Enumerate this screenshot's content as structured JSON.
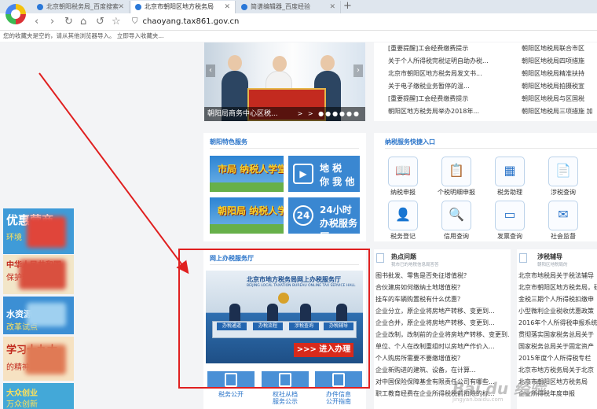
{
  "browser": {
    "tabs": [
      {
        "label": "北京朝阳税务局_百度搜索"
      },
      {
        "label": "北京市朝阳区地方税务局"
      },
      {
        "label": "简谱编辑器_百度经验"
      }
    ],
    "url": "chaoyang.tax861.gov.cn",
    "favbar_text": "您的收藏夹是空的，请从其他浏览器导入。  立即导入收藏夹..."
  },
  "carousel": {
    "caption": "朝阳局商务中心区税...",
    "dots": "> > ●●●●●●"
  },
  "news": {
    "left": [
      "[重要提醒]工会经费缴费提示",
      "关于个人所得税完税证明自助办税...",
      "北京市朝阳区地方税务局发文书...",
      "关于电子缴税业务暂停的温...",
      "[重要提醒]工会经费缴费提示",
      "朝阳区地方税务局举办2018年..."
    ],
    "right": [
      "朝阳区地税局联合市区",
      "朝阳区地税局四项措施",
      "朝阳区地税局精准扶持",
      "朝阳区地税局拍摄税宣",
      "朝阳区地税局与区国税",
      "朝阳区地税局三项措施 加"
    ]
  },
  "featured": {
    "title": "朝阳特色服务",
    "school1": "市局\n纳税人学堂",
    "school2": "朝阳局\n纳税人学堂",
    "tile1_l1": "地 税",
    "tile1_l2": "你 我 他",
    "tile2_l1": "24小时",
    "tile2_l2": "办税服务厅"
  },
  "quick": {
    "title": "纳税服务快捷入口",
    "items": [
      {
        "label": "纳税申报",
        "icon": "📖"
      },
      {
        "label": "个税明细申报",
        "icon": "📋"
      },
      {
        "label": "税务助理",
        "icon": "▦"
      },
      {
        "label": "涉税查询",
        "icon": "📄"
      },
      {
        "label": "税务登记",
        "icon": "👤"
      },
      {
        "label": "信用查询",
        "icon": "🔍"
      },
      {
        "label": "发票查询",
        "icon": "▭"
      },
      {
        "label": "社会监督",
        "icon": "✉"
      }
    ]
  },
  "online_hall": {
    "title": "网上办税服务厅",
    "hall_title": "北京市地方税务局网上办税服务厅",
    "hall_sub": "BEIJING LOCAL TAXATION BUREAU ONLINE TAX SERVICE HALL",
    "desks": [
      "办税通道",
      "办税流程",
      "涉税查询",
      "办税辅导"
    ],
    "enter": ">>> 进入办理",
    "bottom": [
      "税务公开",
      "权社从档\n服务公示",
      "办件信息\n公开指南"
    ]
  },
  "hot": {
    "title": "热点问题",
    "sub": "我市已的地税信息局答答",
    "items": [
      "图书批发、零售是否免征增值税？",
      "合伙建房如何缴纳土地增值税？",
      "挂车的车辆购置税有什么优惠？",
      "企业分立，原企业将房地产转移、变更到...",
      "企业合并，原企业将房地产转移、变更到...",
      "企业改制，改制前的企业将房地产转移、变更到...",
      "单位、个人在改制重组时以房地产作价入...",
      "个人购房所需要不要缴增值税？",
      "企业新购进的建筑、设备，在计算...",
      "对中国保险保障基金有限责任公司有哪些...",
      "职工教育经费在企业所得税税前扣除的标..."
    ]
  },
  "guide": {
    "title": "涉税辅导",
    "sub": "朝阳区地税局的",
    "items": [
      "北京市地税局关于税法辅导",
      "北京市朝阳区地方税务局，研发公",
      "金税三期个人所得税扣缴申",
      "小型微利企业税收优惠政策",
      "2016年个人所得税申报系统",
      "贯彻落实国家税务总局关于",
      "国家税务总局关于固定资产",
      "2015年度个人所得税专栏",
      "北京市地方税务局关于北京",
      "北京市朝阳区地方税务局",
      "企业所得税年度申报"
    ]
  },
  "sidebar_ads": [
    {
      "title": "优惠营商",
      "sub": "环境"
    },
    {
      "title": "中华人民共和国",
      "sub": "保护环境依法"
    },
    {
      "title": "水资源税",
      "sub": "改革试点"
    },
    {
      "title": "学习十九大",
      "sub": "的精神"
    },
    {
      "title": "大众创业",
      "sub": "万众创新"
    }
  ],
  "watermark": {
    "brand": "Bai du 经验",
    "sub": "jingyan.baidu.com"
  },
  "colors": {
    "accent": "#2a74c9",
    "annotation": "#e02020",
    "tile_blue": "#3a87d1"
  }
}
